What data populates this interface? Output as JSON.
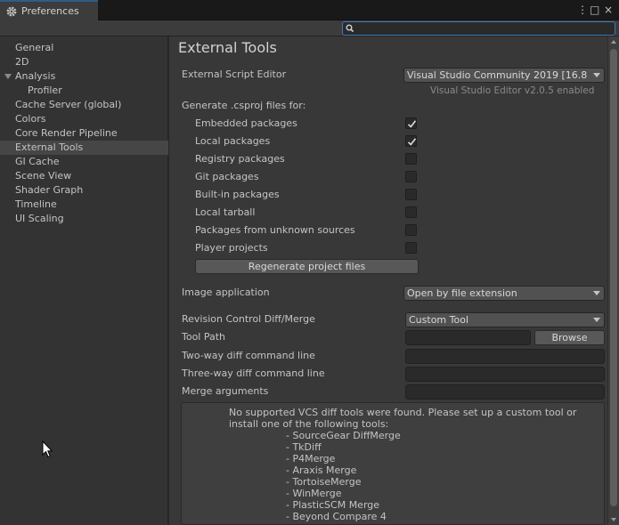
{
  "window": {
    "tab_title": "Preferences",
    "tab_icon": "gear-icon",
    "controls": {
      "menu": "⋮",
      "maximize": "□",
      "close": "×"
    }
  },
  "search": {
    "value": "",
    "placeholder": ""
  },
  "sidebar": {
    "items": [
      {
        "label": "General"
      },
      {
        "label": "2D"
      },
      {
        "label": "Analysis"
      },
      {
        "label": "Profiler"
      },
      {
        "label": "Cache Server (global)"
      },
      {
        "label": "Colors"
      },
      {
        "label": "Core Render Pipeline"
      },
      {
        "label": "External Tools"
      },
      {
        "label": "GI Cache"
      },
      {
        "label": "Scene View"
      },
      {
        "label": "Shader Graph"
      },
      {
        "label": "Timeline"
      },
      {
        "label": "UI Scaling"
      }
    ],
    "selected": "External Tools"
  },
  "main": {
    "title": "External Tools",
    "script_editor": {
      "label": "External Script Editor",
      "value": "Visual Studio Community 2019 [16.8",
      "hint": "Visual Studio Editor v2.0.5 enabled"
    },
    "csproj": {
      "label": "Generate .csproj files for:",
      "options": [
        {
          "label": "Embedded packages",
          "checked": true
        },
        {
          "label": "Local packages",
          "checked": true
        },
        {
          "label": "Registry packages",
          "checked": false
        },
        {
          "label": "Git packages",
          "checked": false
        },
        {
          "label": "Built-in packages",
          "checked": false
        },
        {
          "label": "Local tarball",
          "checked": false
        },
        {
          "label": "Packages from unknown sources",
          "checked": false
        },
        {
          "label": "Player projects",
          "checked": false
        }
      ],
      "regenerate_button": "Regenerate project files"
    },
    "image_app": {
      "label": "Image application",
      "value": "Open by file extension"
    },
    "revision": {
      "label": "Revision Control Diff/Merge",
      "value": "Custom Tool"
    },
    "tool_path": {
      "label": "Tool Path",
      "value": "",
      "browse_button": "Browse"
    },
    "two_way": {
      "label": "Two-way diff command line",
      "value": ""
    },
    "three_way": {
      "label": "Three-way diff command line",
      "value": ""
    },
    "merge_args": {
      "label": "Merge arguments",
      "value": ""
    },
    "help": {
      "message": "No supported VCS diff tools were found. Please set up a custom tool or install one of the following tools:",
      "tools": [
        "- SourceGear DiffMerge",
        "- TkDiff",
        "- P4Merge",
        "- Araxis Merge",
        "- TortoiseMerge",
        "- WinMerge",
        "- PlasticSCM Merge",
        "- Beyond Compare 4"
      ]
    }
  },
  "colors": {
    "background": "#383838",
    "sidebar": "#333333",
    "selected": "#464646",
    "accent": "#3a79bb"
  }
}
